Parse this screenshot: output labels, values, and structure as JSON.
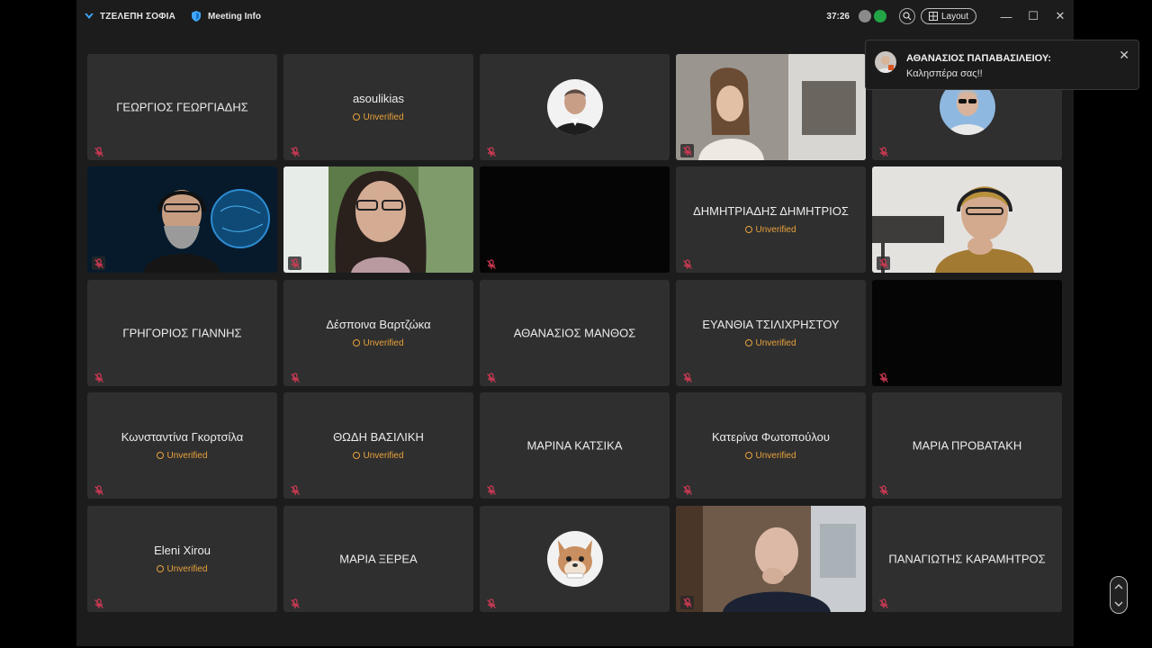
{
  "titlebar": {
    "app_title": "ΤΖΕΛΕΠΗ ΣΟΦΙΑ",
    "meeting_info": "Meeting Info",
    "timer": "37:26",
    "layout_label": "Layout"
  },
  "notification": {
    "sender": "ΑΘΑΝΑΣΙΟΣ ΠΑΠΑΒΑΣΙΛΕΙΟΥ:",
    "message": "Καλησπέρα σας!!"
  },
  "unverified_label": "Unverified",
  "participants": [
    {
      "name": "ΓΕΩΡΓΙΟΣ ΓΕΩΡΓΙΑΔΗΣ",
      "unverified": false
    },
    {
      "name": "asoulikias",
      "unverified": true
    },
    {
      "name": "",
      "avatar": "man-photo"
    },
    {
      "name": "",
      "video": "woman-camera"
    },
    {
      "name": "",
      "avatar": "man-sunglasses-photo"
    },
    {
      "name": "",
      "video": "man-headset-globe"
    },
    {
      "name": "",
      "video": "woman-glasses-outdoor"
    },
    {
      "name": "",
      "video": "black"
    },
    {
      "name": "ΔΗΜΗΤΡΙΑΔΗΣ ΔΗΜΗΤΡΙΟΣ",
      "unverified": true
    },
    {
      "name": "",
      "video": "woman-headset"
    },
    {
      "name": "ΓΡΗΓΟΡΙΟΣ ΓΙΑΝΝΗΣ",
      "unverified": false
    },
    {
      "name": "Δέσποινα Βαρτζώκα",
      "unverified": true
    },
    {
      "name": "ΑΘΑΝΑΣΙΟΣ ΜΑΝΘΟΣ",
      "unverified": false
    },
    {
      "name": "ΕΥΑΝΘΙΑ ΤΣΙΛΙΧΡΗΣΤΟΥ",
      "unverified": true
    },
    {
      "name": "",
      "video": "black"
    },
    {
      "name": "Κωνσταντίνα Γκορτσίλα",
      "unverified": true
    },
    {
      "name": "ΘΩΔΗ ΒΑΣΙΛΙΚΗ",
      "unverified": true
    },
    {
      "name": "ΜΑΡΙΝΑ ΚΑΤΣΙΚΑ",
      "unverified": false
    },
    {
      "name": "Κατερίνα Φωτοπούλου",
      "unverified": true
    },
    {
      "name": "ΜΑΡΙΑ ΠΡΟΒΑΤΑΚΗ",
      "unverified": false
    },
    {
      "name": "Eleni Xirou",
      "unverified": true
    },
    {
      "name": "ΜΑΡΙΑ ΞΕΡΕΑ",
      "unverified": false
    },
    {
      "name": "",
      "avatar": "cartoon-dog"
    },
    {
      "name": "",
      "video": "man-office"
    },
    {
      "name": "ΠΑΝΑΓΙΩΤΗΣ ΚΑΡΑΜΗΤΡΟΣ",
      "unverified": false
    }
  ]
}
